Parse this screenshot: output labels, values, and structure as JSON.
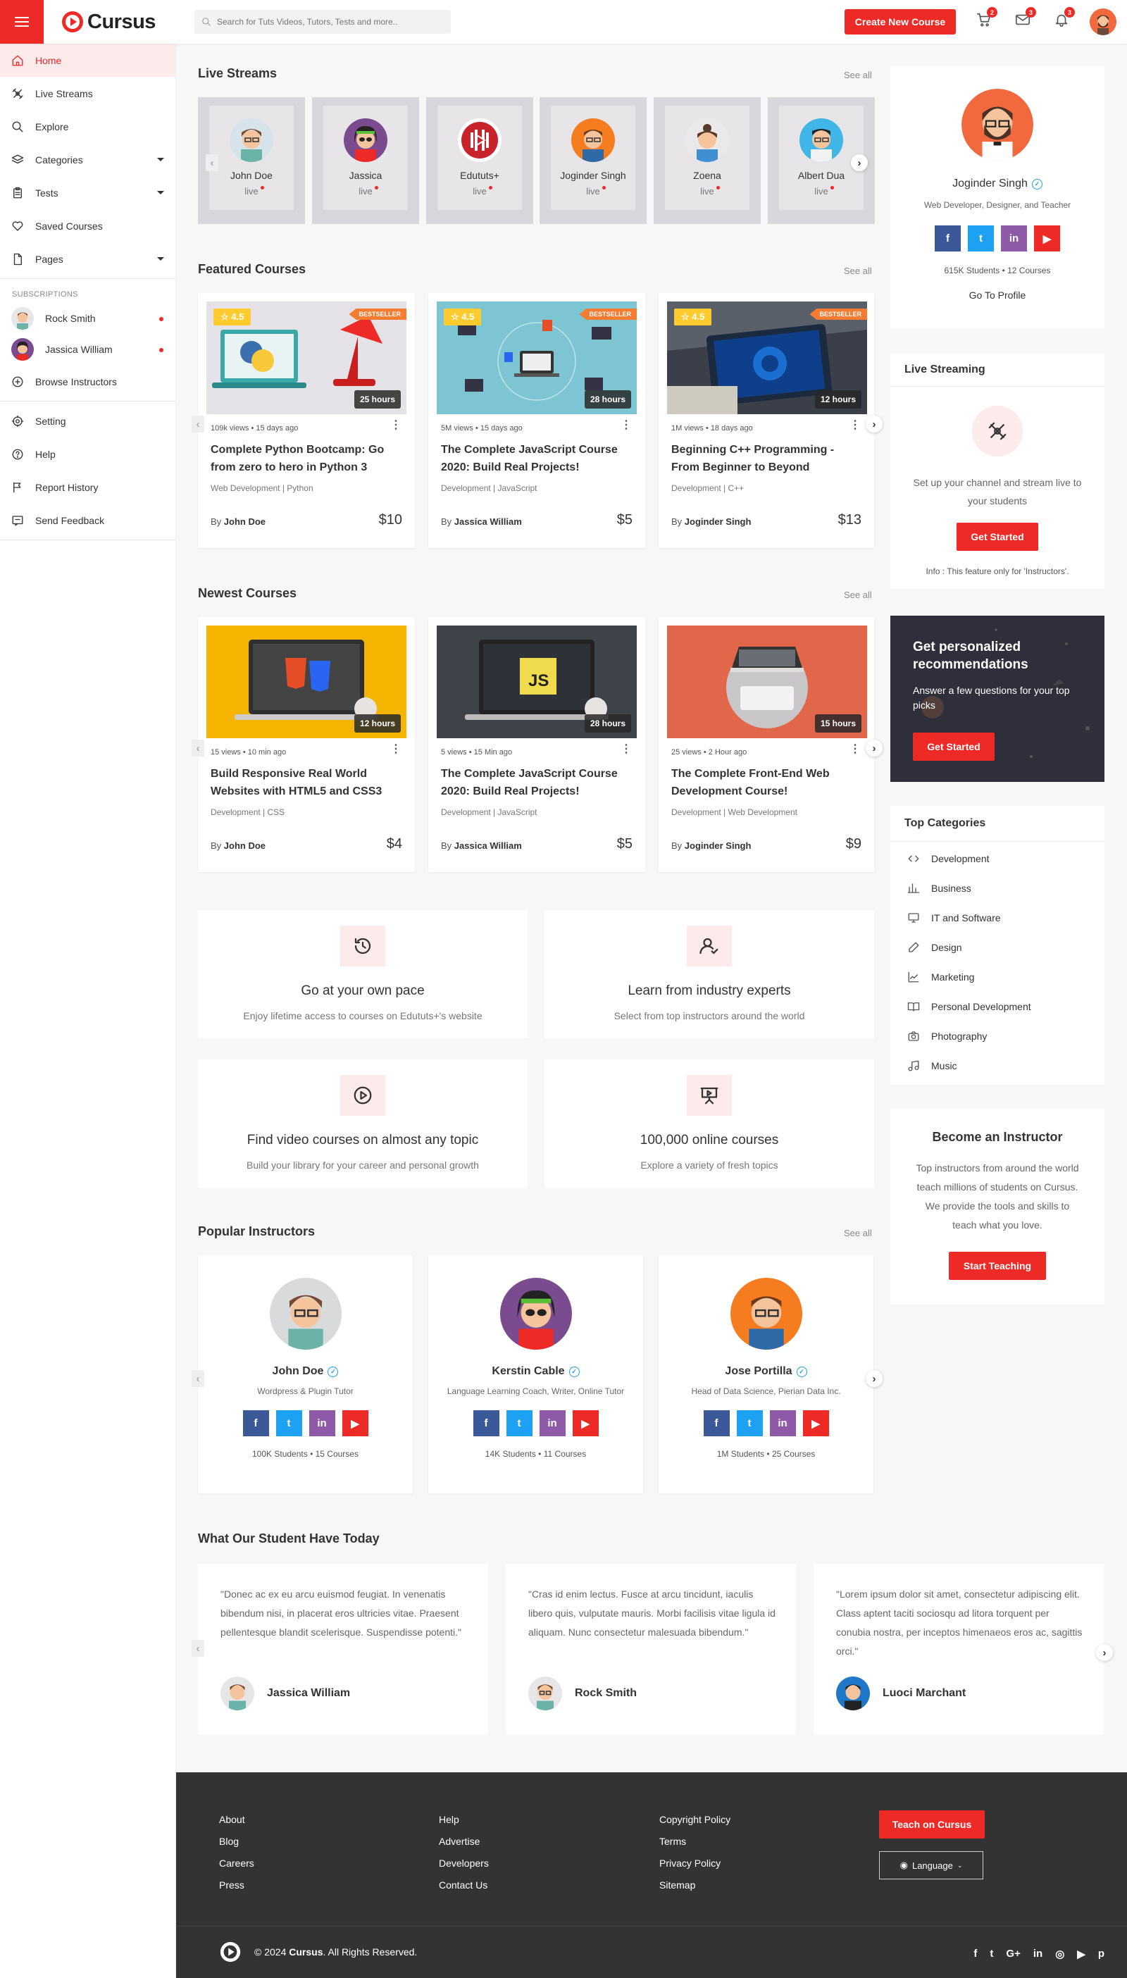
{
  "header": {
    "logo_text": "Cursus",
    "search_placeholder": "Search for Tuts Videos, Tutors, Tests and more..",
    "create_button": "Create New Course",
    "cart_count": "2",
    "mail_count": "3",
    "notif_count": "3"
  },
  "sidebar": {
    "items": [
      {
        "label": "Home",
        "icon": "home-icon"
      },
      {
        "label": "Live Streams",
        "icon": "satellite-icon"
      },
      {
        "label": "Explore",
        "icon": "search-icon"
      },
      {
        "label": "Categories",
        "icon": "layers-icon"
      },
      {
        "label": "Tests",
        "icon": "clipboard-icon"
      },
      {
        "label": "Saved Courses",
        "icon": "heart-icon"
      },
      {
        "label": "Pages",
        "icon": "file-icon"
      }
    ],
    "subscriptions_heading": "SUBSCRIPTIONS",
    "subscriptions": [
      {
        "name": "Rock Smith"
      },
      {
        "name": "Jassica William"
      }
    ],
    "browse": "Browse Instructors",
    "bottom": [
      {
        "label": "Setting",
        "icon": "gear-icon"
      },
      {
        "label": "Help",
        "icon": "help-icon"
      },
      {
        "label": "Report History",
        "icon": "flag-icon"
      },
      {
        "label": "Send Feedback",
        "icon": "feedback-icon"
      }
    ]
  },
  "live": {
    "title": "Live Streams",
    "see_all": "See all",
    "status": "live",
    "items": [
      {
        "name": "John Doe"
      },
      {
        "name": "Jassica"
      },
      {
        "name": "Edututs+"
      },
      {
        "name": "Joginder Singh"
      },
      {
        "name": "Zoena"
      },
      {
        "name": "Albert Dua"
      }
    ]
  },
  "featured": {
    "title": "Featured Courses",
    "see_all": "See all",
    "courses": [
      {
        "rating": "4.5",
        "badge": "BESTSELLER",
        "hours": "25 hours",
        "views": "109k views",
        "ago": "15 days ago",
        "title": "Complete Python Bootcamp: Go from zero to hero in Python 3",
        "category": "Web Development | Python",
        "by": "By",
        "author": "John Doe",
        "price": "$10"
      },
      {
        "rating": "4.5",
        "badge": "BESTSELLER",
        "hours": "28 hours",
        "views": "5M views",
        "ago": "15 days ago",
        "title": "The Complete JavaScript Course 2020: Build Real Projects!",
        "category": "Development | JavaScript",
        "by": "By",
        "author": "Jassica William",
        "price": "$5"
      },
      {
        "rating": "4.5",
        "badge": "BESTSELLER",
        "hours": "12 hours",
        "views": "1M views",
        "ago": "18 days ago",
        "title": "Beginning C++ Programming - From Beginner to Beyond",
        "category": "Development | C++",
        "by": "By",
        "author": "Joginder Singh",
        "price": "$13"
      }
    ]
  },
  "newest": {
    "title": "Newest Courses",
    "see_all": "See all",
    "courses": [
      {
        "hours": "12 hours",
        "views": "15 views",
        "ago": "10 min ago",
        "title": "Build Responsive Real World Websites with HTML5 and CSS3",
        "category": "Development | CSS",
        "by": "By",
        "author": "John Doe",
        "price": "$4"
      },
      {
        "hours": "28 hours",
        "views": "5 views",
        "ago": "15 Min ago",
        "title": "The Complete JavaScript Course 2020: Build Real Projects!",
        "category": "Development | JavaScript",
        "by": "By",
        "author": "Jassica William",
        "price": "$5"
      },
      {
        "hours": "15 hours",
        "views": "25 views",
        "ago": "2 Hour ago",
        "title": "The Complete Front-End Web Development Course!",
        "category": "Development | Web Development",
        "by": "By",
        "author": "Joginder Singh",
        "price": "$9"
      }
    ]
  },
  "features": [
    {
      "title": "Go at your own pace",
      "desc": "Enjoy lifetime access to courses on Edututs+'s website",
      "icon": "history-icon"
    },
    {
      "title": "Learn from industry experts",
      "desc": "Select from top instructors around the world",
      "icon": "user-check-icon"
    },
    {
      "title": "Find video courses on almost any topic",
      "desc": "Build your library for your career and personal growth",
      "icon": "play-circle-icon"
    },
    {
      "title": "100,000 online courses",
      "desc": "Explore a variety of fresh topics",
      "icon": "presentation-icon"
    }
  ],
  "instructors": {
    "title": "Popular Instructors",
    "see_all": "See all",
    "items": [
      {
        "name": "John Doe",
        "role": "Wordpress & Plugin Tutor",
        "students": "100K Students",
        "courses": "15 Courses"
      },
      {
        "name": "Kerstin Cable",
        "role": "Language Learning Coach, Writer, Online Tutor",
        "students": "14K Students",
        "courses": "11 Courses"
      },
      {
        "name": "Jose Portilla",
        "role": "Head of Data Science, Pierian Data Inc.",
        "students": "1M Students",
        "courses": "25 Courses"
      }
    ]
  },
  "testimonials": {
    "title": "What Our Student Have Today",
    "items": [
      {
        "quote": "\"Donec ac ex eu arcu euismod feugiat. In venenatis bibendum nisi, in placerat eros ultricies vitae. Praesent pellentesque blandit scelerisque. Suspendisse potenti.\"",
        "name": "Jassica William"
      },
      {
        "quote": "\"Cras id enim lectus. Fusce at arcu tincidunt, iaculis libero quis, vulputate mauris. Morbi facilisis vitae ligula id aliquam. Nunc consectetur malesuada bibendum.\"",
        "name": "Rock Smith"
      },
      {
        "quote": "\"Lorem ipsum dolor sit amet, consectetur adipiscing elit. Class aptent taciti sociosqu ad litora torquent per conubia nostra, per inceptos himenaeos eros ac, sagittis orci.\"",
        "name": "Luoci Marchant"
      }
    ]
  },
  "profile": {
    "name": "Joginder Singh",
    "role": "Web Developer, Designer, and Teacher",
    "students": "615K Students",
    "courses": "12 Courses",
    "link": "Go To Profile"
  },
  "live_streaming": {
    "title": "Live Streaming",
    "text": "Set up your channel and stream live to your students",
    "button": "Get Started",
    "info": "Info : This feature only for 'Instructors'."
  },
  "recommend": {
    "title": "Get personalized recommendations",
    "text": "Answer a few questions for your top picks",
    "button": "Get Started"
  },
  "categories": {
    "title": "Top Categories",
    "items": [
      {
        "label": "Development",
        "icon": "code-icon"
      },
      {
        "label": "Business",
        "icon": "bar-chart-icon"
      },
      {
        "label": "IT and Software",
        "icon": "monitor-icon"
      },
      {
        "label": "Design",
        "icon": "pen-icon"
      },
      {
        "label": "Marketing",
        "icon": "line-chart-icon"
      },
      {
        "label": "Personal Development",
        "icon": "book-icon"
      },
      {
        "label": "Photography",
        "icon": "camera-icon"
      },
      {
        "label": "Music",
        "icon": "music-icon"
      }
    ]
  },
  "become": {
    "title": "Become an Instructor",
    "text": "Top instructors from around the world teach millions of students on Cursus. We provide the tools and skills to teach what you love.",
    "button": "Start Teaching"
  },
  "footer": {
    "col1": [
      "About",
      "Blog",
      "Careers",
      "Press"
    ],
    "col2": [
      "Help",
      "Advertise",
      "Developers",
      "Contact Us"
    ],
    "col3": [
      "Copyright Policy",
      "Terms",
      "Privacy Policy",
      "Sitemap"
    ],
    "teach_button": "Teach on Cursus",
    "language": "Language",
    "copyright_pre": "© 2024 ",
    "copyright_brand": "Cursus",
    "copyright_post": ". All Rights Reserved.",
    "social": [
      "facebook-icon",
      "twitter-icon",
      "google-plus-icon",
      "linkedin-icon",
      "instagram-icon",
      "youtube-icon",
      "pinterest-icon"
    ]
  },
  "colors": {
    "accent": "#ed2a26",
    "footer": "#333333",
    "badge": "#f57c31",
    "rating": "#ffcb2f"
  }
}
